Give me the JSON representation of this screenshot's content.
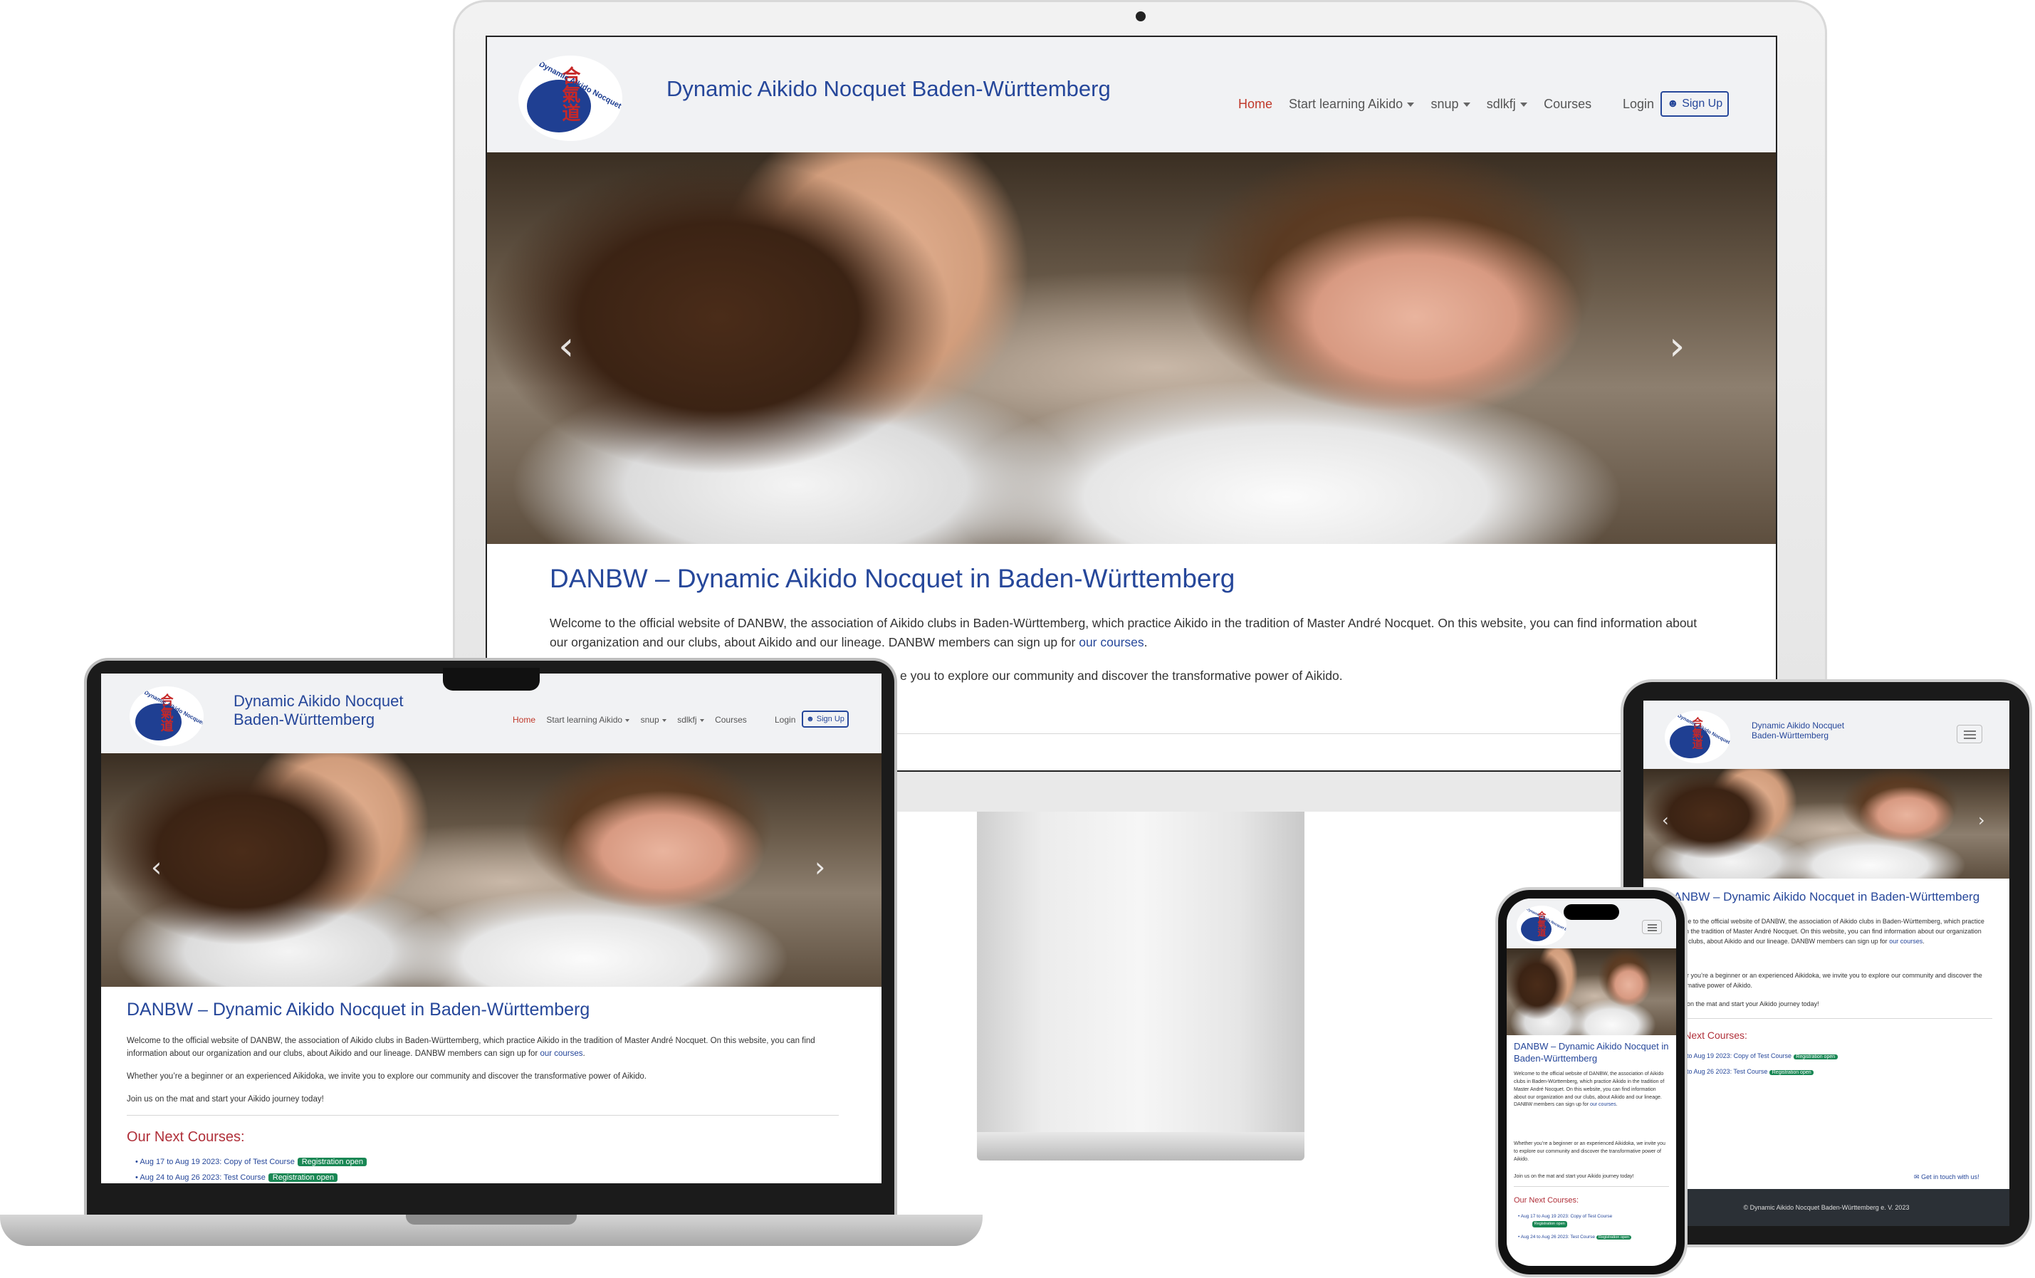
{
  "site": {
    "title": "Dynamic Aikido Nocquet Baden-Württemberg",
    "title_line1": "Dynamic Aikido Nocquet",
    "title_line2": "Baden-Württemberg",
    "logo_text": "Dynamic Aikido Nocquet BW e.V.",
    "logo_glyph": "合氣道"
  },
  "nav": {
    "home": "Home",
    "start_learning": "Start learning Aikido",
    "snup": "snup",
    "sdlkfj": "sdlkfj",
    "courses": "Courses",
    "login": "Login",
    "signup": "Sign Up"
  },
  "hero": {
    "prev_icon": "chevron-left-icon",
    "next_icon": "chevron-right-icon",
    "prev_glyph": "‹",
    "next_glyph": "›"
  },
  "main": {
    "heading": "DANBW – Dynamic Aikido Nocquet in Baden-Württemberg",
    "heading_line1": "DANBW – Dynamic Aikido Nocquet in",
    "heading_line2": "Baden-Württemberg",
    "intro": "Welcome to the official website of DANBW, the association of Aikido clubs in Baden-Württemberg, which practice Aikido in the tradition of Master André Nocquet. On this website, you can find information about our organization and our clubs, about Aikido and our lineage. DANBW members can sign up for",
    "intro_link": "our courses",
    "intro_end": ".",
    "beginner": "Whether you’re a beginner or an experienced Aikidoka, we invite you to explore our community and discover the transformative power of Aikido.",
    "beginner_tail": "e you to explore our community and discover the transformative power of Aikido.",
    "join": "Join us on the mat and start your Aikido journey today!",
    "courses_heading": "Our Next Courses:",
    "courses": [
      {
        "label": "Aug 17 to Aug 19 2023: Copy of Test Course",
        "badge": "Registration open"
      },
      {
        "label": "Aug 24 to Aug 26 2023: Test Course",
        "badge": "Registration open"
      }
    ]
  },
  "footer": {
    "contact": "Get in touch with us!",
    "copyright": "© Dynamic Aikido Nocquet Baden-Württemberg e. V. 2023"
  },
  "colors": {
    "brand_blue": "#26479a",
    "home_red": "#c0392b",
    "badge_green": "#198754",
    "footer_dark": "#2b3036"
  }
}
